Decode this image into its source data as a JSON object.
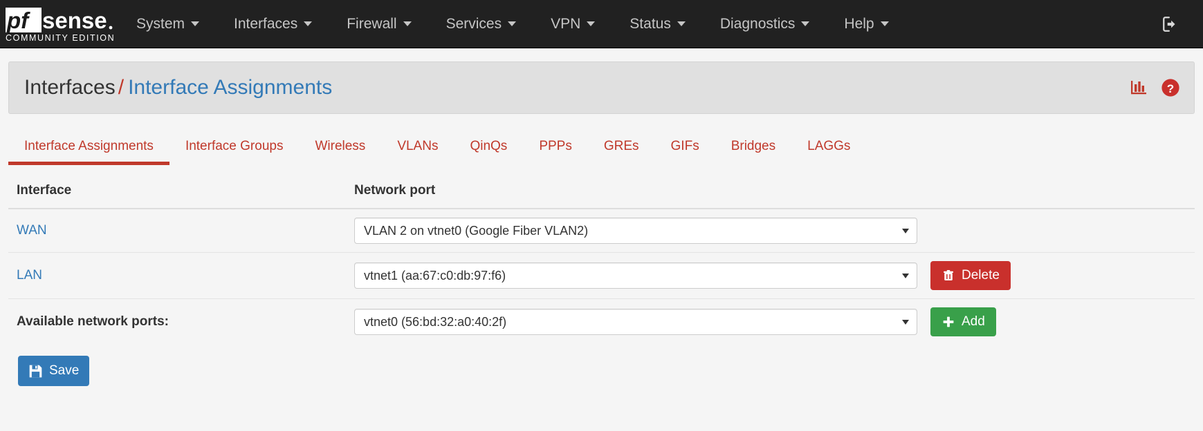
{
  "navbar": {
    "brand_name": "pfsense",
    "brand_subtitle": "COMMUNITY EDITION",
    "items": [
      {
        "label": "System"
      },
      {
        "label": "Interfaces"
      },
      {
        "label": "Firewall"
      },
      {
        "label": "Services"
      },
      {
        "label": "VPN"
      },
      {
        "label": "Status"
      },
      {
        "label": "Diagnostics"
      },
      {
        "label": "Help"
      }
    ],
    "logout_icon": "logout-icon"
  },
  "breadcrumb": {
    "parent": "Interfaces",
    "separator": "/",
    "current": "Interface Assignments",
    "icons": [
      {
        "name": "status-chart-icon"
      },
      {
        "name": "help-icon"
      }
    ]
  },
  "tabs": [
    {
      "label": "Interface Assignments",
      "active": true
    },
    {
      "label": "Interface Groups",
      "active": false
    },
    {
      "label": "Wireless",
      "active": false
    },
    {
      "label": "VLANs",
      "active": false
    },
    {
      "label": "QinQs",
      "active": false
    },
    {
      "label": "PPPs",
      "active": false
    },
    {
      "label": "GREs",
      "active": false
    },
    {
      "label": "GIFs",
      "active": false
    },
    {
      "label": "Bridges",
      "active": false
    },
    {
      "label": "LAGGs",
      "active": false
    }
  ],
  "table": {
    "headers": {
      "interface": "Interface",
      "network_port": "Network port"
    },
    "rows": [
      {
        "interface": "WAN",
        "port_value": "VLAN 2 on vtnet0 (Google Fiber VLAN2)",
        "has_delete": false
      },
      {
        "interface": "LAN",
        "port_value": "vtnet1 (aa:67:c0:db:97:f6)",
        "has_delete": true,
        "delete_label": "Delete"
      }
    ],
    "available": {
      "label": "Available network ports:",
      "port_value": "vtnet0 (56:bd:32:a0:40:2f)",
      "add_label": "Add"
    }
  },
  "actions": {
    "save_label": "Save"
  },
  "colors": {
    "navbar_bg": "#212121",
    "accent_red": "#c0392b",
    "link_blue": "#337ab7",
    "danger": "#c9302c",
    "success": "#39a04a",
    "primary": "#337ab7"
  }
}
